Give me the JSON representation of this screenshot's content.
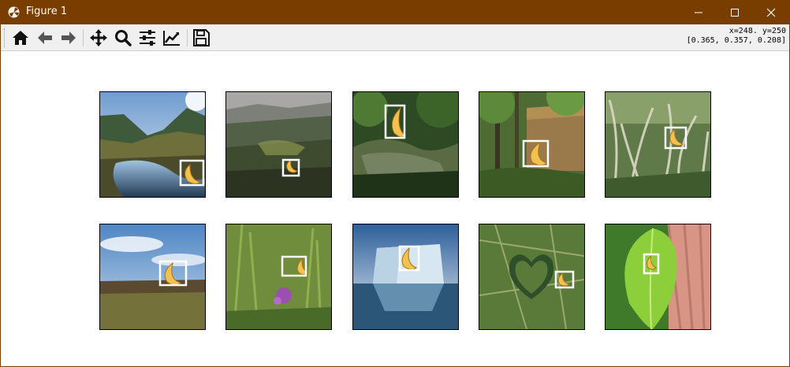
{
  "window": {
    "title": "Figure 1",
    "title_bar_color": "#7a3d00"
  },
  "titlebar_buttons": [
    {
      "name": "minimize",
      "icon": "minimize-icon"
    },
    {
      "name": "maximize",
      "icon": "maximize-icon"
    },
    {
      "name": "close",
      "icon": "close-icon"
    }
  ],
  "toolbar": {
    "tools": [
      {
        "name": "home",
        "icon": "home-icon"
      },
      {
        "name": "back",
        "icon": "arrow-left-icon"
      },
      {
        "name": "forward",
        "icon": "arrow-right-icon"
      },
      {
        "name": "pan",
        "icon": "move-icon"
      },
      {
        "name": "zoom",
        "icon": "magnifier-icon"
      },
      {
        "name": "configure-subplots",
        "icon": "sliders-icon"
      },
      {
        "name": "edit-axes",
        "icon": "line-chart-icon"
      },
      {
        "name": "save",
        "icon": "floppy-disk-icon"
      }
    ]
  },
  "status": {
    "coords": "x=248. y=250",
    "pixel_value": "[0.365, 0.357, 0.208]"
  },
  "figure": {
    "grid": "2 rows x 5 columns of image panels",
    "box_color": "#ffffff",
    "panels": [
      {
        "scene": "mountain valley with stream",
        "object": "banana"
      },
      {
        "scene": "hazy hillside forest",
        "object": "banana"
      },
      {
        "scene": "mossy forest creek",
        "object": "banana"
      },
      {
        "scene": "forest cliff with trees",
        "object": "banana"
      },
      {
        "scene": "pampas grass field",
        "object": "banana"
      },
      {
        "scene": "meadow under cloudy sky",
        "object": "banana"
      },
      {
        "scene": "wildflower meadow with purple thistle",
        "object": "banana"
      },
      {
        "scene": "iceberg on water",
        "object": "banana"
      },
      {
        "scene": "aerial heart-shaped forest",
        "object": "banana"
      },
      {
        "scene": "green leaf on tree bark",
        "object": "banana"
      }
    ]
  }
}
